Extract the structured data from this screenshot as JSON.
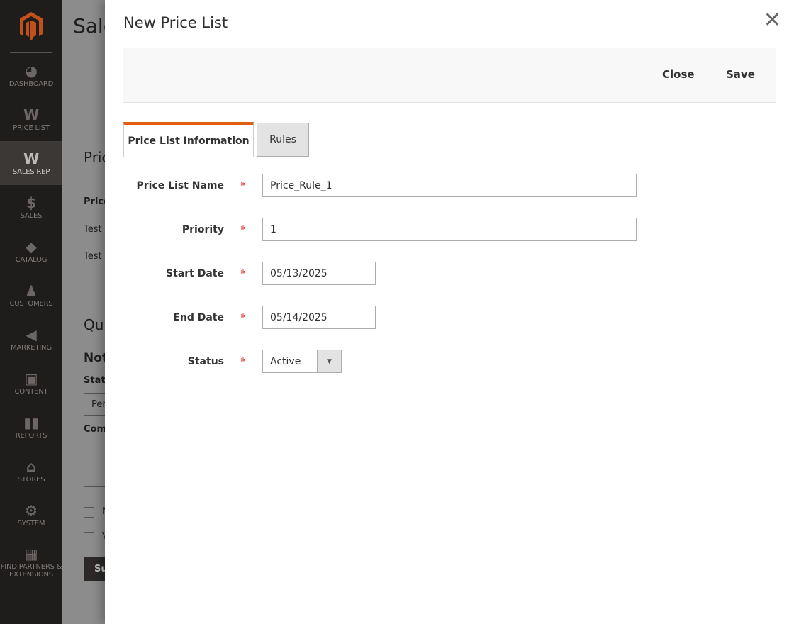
{
  "sidebar": {
    "items": [
      {
        "label": "DASHBOARD",
        "icon": "dashboard-icon"
      },
      {
        "label": "PRICE LIST",
        "icon": "w-logo-icon"
      },
      {
        "label": "SALES REP",
        "icon": "w-logo-icon",
        "active": true
      },
      {
        "label": "SALES",
        "icon": "dollar-icon"
      },
      {
        "label": "CATALOG",
        "icon": "box-icon"
      },
      {
        "label": "CUSTOMERS",
        "icon": "person-icon"
      },
      {
        "label": "MARKETING",
        "icon": "megaphone-icon"
      },
      {
        "label": "CONTENT",
        "icon": "layout-icon"
      },
      {
        "label": "REPORTS",
        "icon": "bar-chart-icon"
      },
      {
        "label": "STORES",
        "icon": "store-icon"
      },
      {
        "label": "SYSTEM",
        "icon": "gear-icon"
      }
    ],
    "partners": "FIND PARTNERS & EXTENSIONS"
  },
  "background": {
    "page_title": "Sale",
    "section1": "Pric",
    "col_header": "Price",
    "row1": "Test I",
    "row2": "Test I",
    "section2": "Qu",
    "notes": "Not",
    "status_label": "Statu",
    "status_value": "Per",
    "comment_label": "Com",
    "check1": "N",
    "check2": "V",
    "submit": "Su"
  },
  "modal": {
    "title": "New Price List",
    "close_label": "Close",
    "save_label": "Save",
    "tabs": [
      {
        "label": "Price List Information",
        "active": true
      },
      {
        "label": "Rules"
      }
    ],
    "fields": {
      "name": {
        "label": "Price List Name",
        "value": "Price_Rule_1"
      },
      "priority": {
        "label": "Priority",
        "value": "1"
      },
      "start": {
        "label": "Start Date",
        "value": "05/13/2025"
      },
      "end": {
        "label": "End Date",
        "value": "05/14/2025"
      },
      "status": {
        "label": "Status",
        "value": "Active"
      }
    },
    "required_mark": "*"
  },
  "colors": {
    "accent": "#e35d0e",
    "required": "#e22626"
  }
}
